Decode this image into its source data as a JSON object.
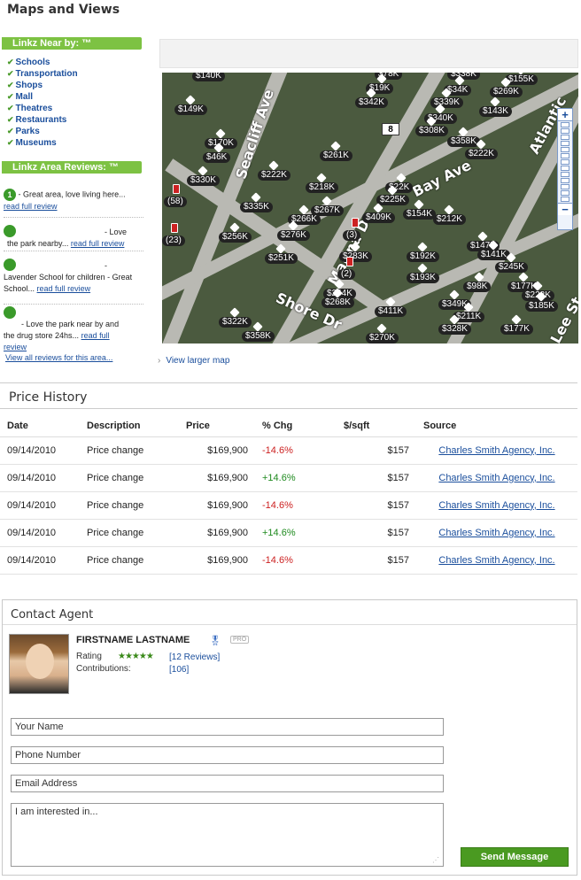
{
  "maps": {
    "title": "Maps and Views",
    "near_title": "Linkz Near by: ™",
    "near_items": [
      "Schools",
      "Transportation",
      "Shops",
      "Mall",
      "Theatres",
      "Restaurants",
      "Parks",
      "Museums"
    ],
    "reviews_title": "Linkz Area Reviews: ™",
    "reviews": [
      {
        "num": "1",
        "text": "- Great area, love living here...",
        "link": "read full review"
      },
      {
        "num": "",
        "text": "- Love the park nearby...",
        "link": "read full review"
      },
      {
        "num": "",
        "text": "- Lavender School for children - Great School...",
        "link": "read full review"
      },
      {
        "num": "",
        "text": "- Love the park near by and the drug store 24hs...",
        "link": "read full review"
      }
    ],
    "view_all": "View all reviews for this area...",
    "view_larger": "View larger map",
    "map": {
      "roads": [
        "Seacliff Ave",
        "Bay Ave",
        "Marina Dr",
        "Shore Dr",
        "Atlantic",
        "Lee St"
      ],
      "route_shield": "8",
      "prices": [
        "$140K",
        "$78K",
        "$338K",
        "$155K",
        "$19K",
        "$34K",
        "$269K",
        "$149K",
        "$342K",
        "$339K",
        "$143K",
        "$340K",
        "$308K",
        "$170K",
        "$358K",
        "$222K",
        "$261K",
        "$46K",
        "$330K",
        "$222K",
        "$218K",
        "$335K",
        "$267K",
        "$22K",
        "$225K",
        "$154K",
        "$212K",
        "$266K",
        "$256K",
        "$276K",
        "$409K",
        "$283K",
        "$251K",
        "$147K",
        "$192K",
        "$141K",
        "$245K",
        "$193K",
        "$244K",
        "$98K",
        "$177K",
        "$268K",
        "$349K",
        "$228K",
        "$185K",
        "$211K",
        "$322K",
        "$411K",
        "$358K",
        "$328K",
        "$177K",
        "$270K"
      ],
      "clusters": [
        "(58)",
        "(23)",
        "(3)",
        "(2)"
      ],
      "zoom_in": "+",
      "zoom_out": "−"
    }
  },
  "price_history": {
    "title": "Price History",
    "headers": [
      "Date",
      "Description",
      "Price",
      "% Chg",
      "$/sqft",
      "Source"
    ],
    "rows": [
      {
        "date": "09/14/2010",
        "desc": "Price change",
        "price": "$169,900",
        "chg": "-14.6%",
        "sqft": "$157",
        "source": "Charles Smith Agency, Inc."
      },
      {
        "date": "09/14/2010",
        "desc": "Price change",
        "price": "$169,900",
        "chg": "+14.6%",
        "sqft": "$157",
        "source": "Charles Smith Agency, Inc."
      },
      {
        "date": "09/14/2010",
        "desc": "Price change",
        "price": "$169,900",
        "chg": "-14.6%",
        "sqft": "$157",
        "source": "Charles Smith Agency, Inc."
      },
      {
        "date": "09/14/2010",
        "desc": "Price change",
        "price": "$169,900",
        "chg": "+14.6%",
        "sqft": "$157",
        "source": "Charles Smith Agency, Inc."
      },
      {
        "date": "09/14/2010",
        "desc": "Price change",
        "price": "$169,900",
        "chg": "-14.6%",
        "sqft": "$157",
        "source": "Charles Smith Agency, Inc."
      }
    ]
  },
  "contact": {
    "title": "Contact Agent",
    "agent_name": "FIRSTNAME LASTNAME",
    "pro_badge": "PRO",
    "rating_label": "Rating",
    "stars": "★★★★★",
    "reviews_link": "[12 Reviews]",
    "contrib_label": "Contributions:",
    "contrib_value": "[106]",
    "fields": {
      "name": "Your Name",
      "phone": "Phone Number",
      "email": "Email Address",
      "message": "I am interested in..."
    },
    "send_label": "Send Message"
  },
  "colors": {
    "accent_green": "#7dc243",
    "link_blue": "#1a4e9c",
    "negative": "#cc1f1f",
    "positive": "#1e8a1e"
  }
}
